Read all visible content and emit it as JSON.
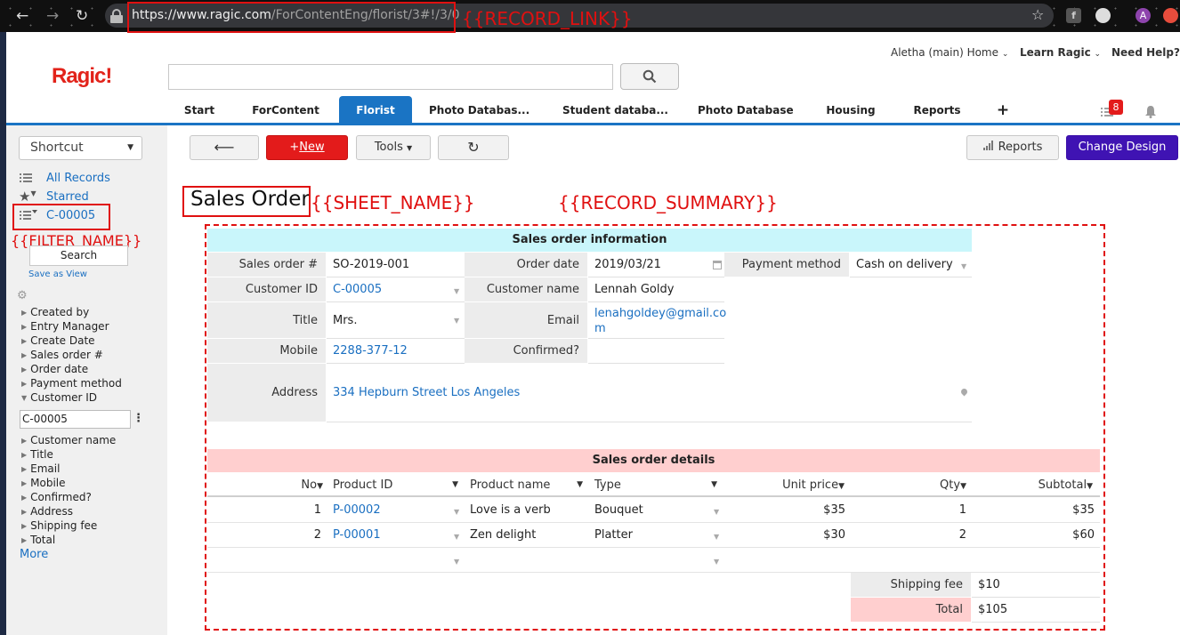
{
  "browser": {
    "url_host": "https://www.ragic.com",
    "url_path": "/ForContentEng/florist/3#!/3/0",
    "avatar_letter": "A"
  },
  "annotations": {
    "record_link": "{{RECORD_LINK}}",
    "sheet_name": "{{SHEET_NAME}}",
    "record_summary": "{{RECORD_SUMMARY}}",
    "filter_name": "{{FILTER_NAME}}"
  },
  "app": {
    "logo": "Ragic!",
    "top_nav": {
      "account": "Aletha (main) Home",
      "learn": "Learn Ragic",
      "help": "Need Help?"
    },
    "tabs": [
      "Start",
      "ForContent",
      "Florist",
      "Photo Databas...",
      "Student databa...",
      "Photo Database",
      "Housing",
      "Reports",
      "+"
    ],
    "active_tab": "Florist",
    "notification_count": "8"
  },
  "sidebar": {
    "shortcut_label": "Shortcut",
    "all_records": "All Records",
    "starred": "Starred",
    "current_filter": "C-00005",
    "search_button": "Search",
    "save_as_view": "Save as View",
    "filter_fields_top": [
      "Created by",
      "Entry Manager",
      "Create Date",
      "Sales order #",
      "Order date",
      "Payment method"
    ],
    "expanded_field": "Customer ID",
    "expanded_value": "C-00005",
    "filter_fields_bottom": [
      "Customer name",
      "Title",
      "Email",
      "Mobile",
      "Confirmed?",
      "Address",
      "Shipping fee",
      "Total"
    ],
    "more": "More"
  },
  "toolbar": {
    "back": "⟵",
    "new_plus": "+",
    "new_label": "New",
    "tools": "Tools",
    "refresh": "↻",
    "reports": "Reports",
    "change_design": "Change Design"
  },
  "form": {
    "sheet_title": "Sales Order",
    "info_header": "Sales order information",
    "fields": {
      "sales_order_label": "Sales order #",
      "sales_order_value": "SO-2019-001",
      "order_date_label": "Order date",
      "order_date_value": "2019/03/21",
      "payment_label": "Payment method",
      "payment_value": "Cash on delivery",
      "customer_id_label": "Customer ID",
      "customer_id_value": "C-00005",
      "customer_name_label": "Customer name",
      "customer_name_value": "Lennah Goldy",
      "title_label": "Title",
      "title_value": "Mrs.",
      "email_label": "Email",
      "email_value_line1": "lenahgoldey@gmail.co",
      "email_value_line2": "m",
      "mobile_label": "Mobile",
      "mobile_value": "2288-377-12",
      "confirmed_label": "Confirmed?",
      "confirmed_value": "",
      "address_label": "Address",
      "address_value": "334 Hepburn Street Los Angeles"
    },
    "details_header": "Sales order details",
    "grid": {
      "columns": [
        "No",
        "Product ID",
        "Product name",
        "Type",
        "Unit price",
        "Qty",
        "Subtotal"
      ],
      "rows": [
        {
          "no": "1",
          "product_id": "P-00002",
          "product_name": "Love is a verb",
          "type": "Bouquet",
          "unit_price": "$35",
          "qty": "1",
          "subtotal": "$35"
        },
        {
          "no": "2",
          "product_id": "P-00001",
          "product_name": "Zen delight",
          "type": "Platter",
          "unit_price": "$30",
          "qty": "2",
          "subtotal": "$60"
        }
      ]
    },
    "shipping_fee_label": "Shipping fee",
    "shipping_fee_value": "$10",
    "total_label": "Total",
    "total_value": "$105"
  }
}
